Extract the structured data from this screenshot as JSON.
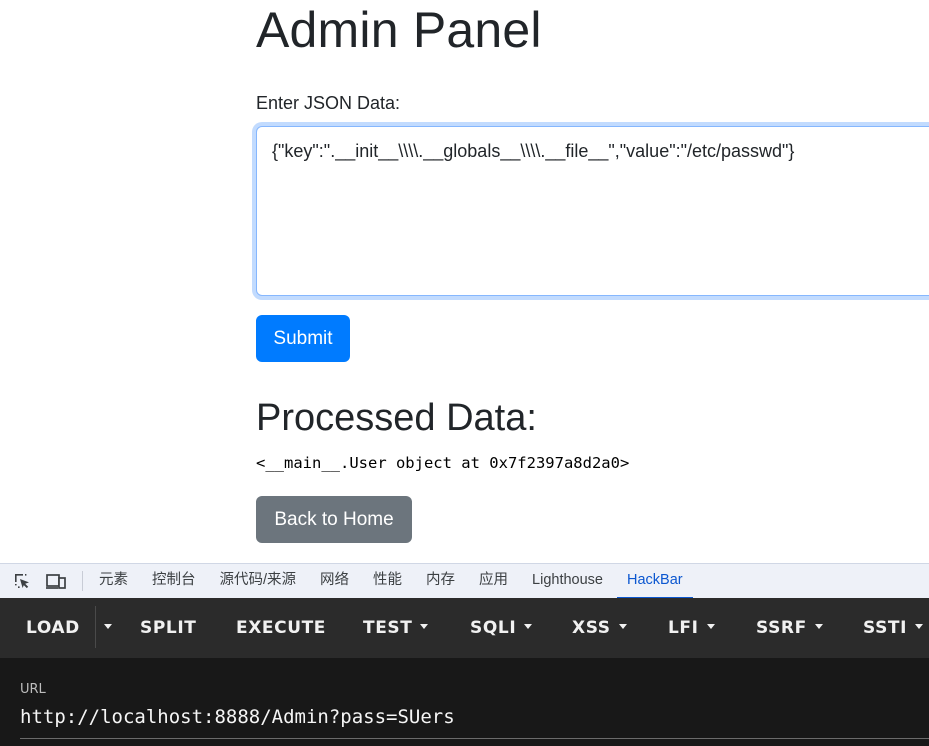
{
  "page": {
    "title": "Admin Panel",
    "json_label": "Enter JSON Data:",
    "json_value": "{\"key\":\".__init__\\\\\\\\.__globals__\\\\\\\\.__file__\",\"value\":\"/etc/passwd\"}",
    "submit_label": "Submit",
    "processed_heading": "Processed Data:",
    "processed_result": "<__main__.User object at 0x7f2397a8d2a0>",
    "back_label": "Back to Home"
  },
  "devtools": {
    "tabs": [
      {
        "label": "元素"
      },
      {
        "label": "控制台"
      },
      {
        "label": "源代码/来源"
      },
      {
        "label": "网络"
      },
      {
        "label": "性能"
      },
      {
        "label": "内存"
      },
      {
        "label": "应用"
      },
      {
        "label": "Lighthouse"
      },
      {
        "label": "HackBar"
      }
    ],
    "active_tab": "HackBar"
  },
  "hackbar": {
    "buttons": [
      {
        "label": "LOAD"
      },
      {
        "label": "SPLIT"
      },
      {
        "label": "EXECUTE"
      },
      {
        "label": "TEST"
      },
      {
        "label": "SQLI"
      },
      {
        "label": "XSS"
      },
      {
        "label": "LFI"
      },
      {
        "label": "SSRF"
      },
      {
        "label": "SSTI"
      }
    ],
    "url_label": "URL",
    "url_value": "http://localhost:8888/Admin?pass=SUers"
  },
  "colors": {
    "primary": "#007bff",
    "secondary": "#6c757d",
    "hackbar_bg": "#2b2b2b",
    "active_tab": "#0b57d0"
  }
}
